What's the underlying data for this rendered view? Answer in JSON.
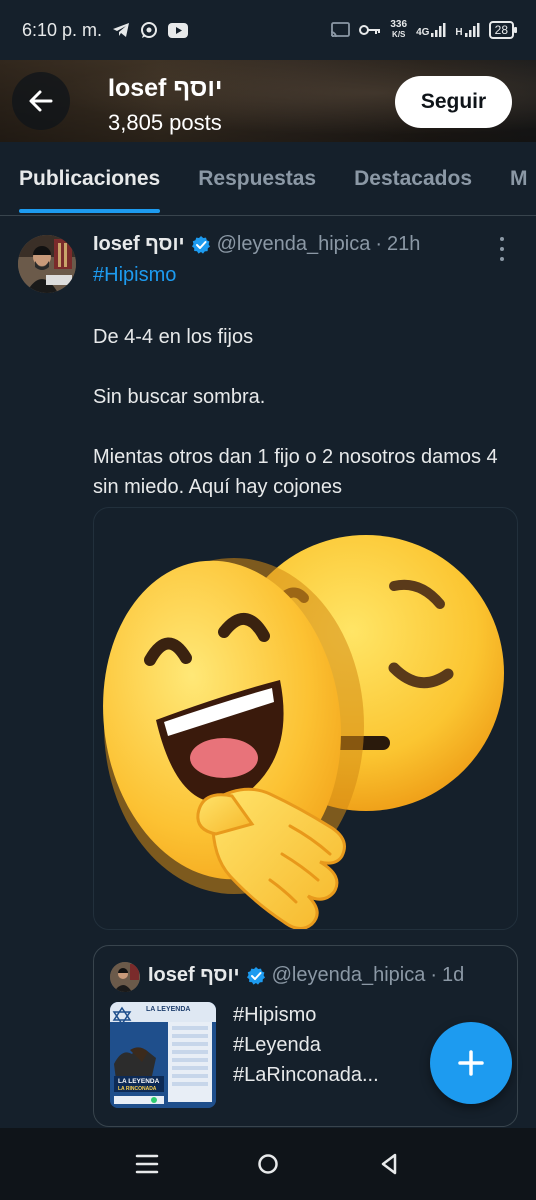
{
  "status_bar": {
    "time": "6:10 p. m.",
    "left_icons": [
      "telegram-icon",
      "whatsapp-icon",
      "youtube-icon"
    ],
    "right_icons": [
      "cast-icon",
      "vpn-key-icon"
    ],
    "speed_value": "336",
    "speed_unit": "K/S",
    "network_type": "4G",
    "network_type2": "H",
    "battery": "28"
  },
  "header": {
    "name": "Iosef יוסף",
    "posts": "3,805 posts",
    "follow_label": "Seguir"
  },
  "tabs": [
    {
      "label": "Publicaciones",
      "active": true
    },
    {
      "label": "Respuestas",
      "active": false
    },
    {
      "label": "Destacados",
      "active": false
    },
    {
      "label": "M",
      "active": false
    }
  ],
  "tweet": {
    "author": "Iosef יוסף",
    "handle": "@leyenda_hipica",
    "dot": "·",
    "time": "21h",
    "hashtag": "#Hipismo",
    "lines": [
      "De 4-4 en los fijos",
      "Sin buscar sombra.",
      "Mientas otros dan 1 fijo o 2 nosotros damos 4 sin miedo. Aquí hay cojones"
    ],
    "media": "hiding-behind-smiling-mask-emoji"
  },
  "quote": {
    "author": "Iosef יוסף",
    "handle": "@leyenda_hipica",
    "dot": "·",
    "time": "1d",
    "lines": [
      "#Hipismo",
      "#Leyenda",
      "#LaRinconada..."
    ],
    "thumb_title": "LA LEYENDA",
    "thumb_subtitle": "LA RINCONADA"
  },
  "colors": {
    "background": "#15202b",
    "accent": "#1d9bf0",
    "muted": "#8b98a5"
  }
}
